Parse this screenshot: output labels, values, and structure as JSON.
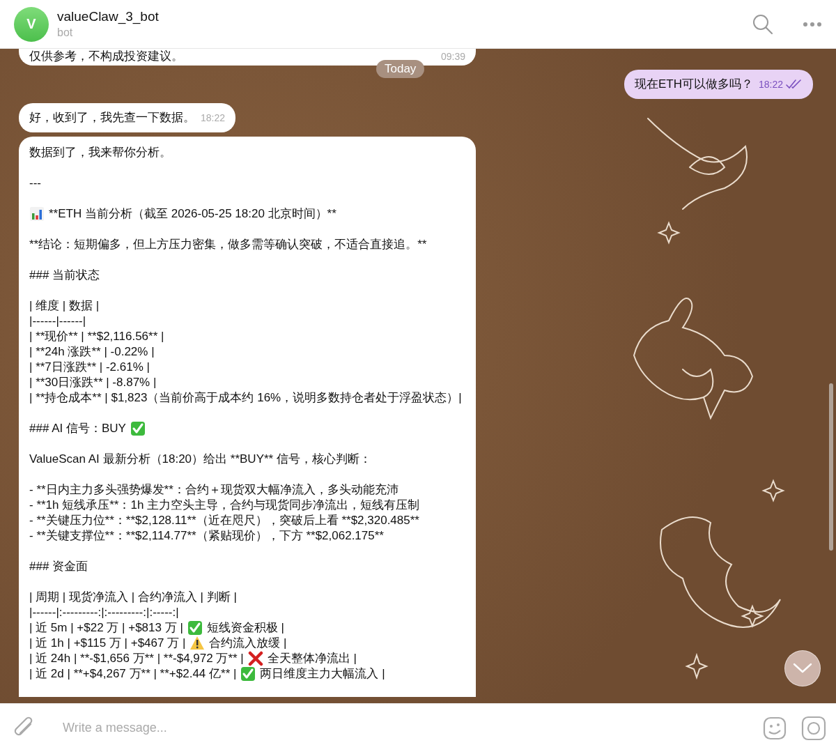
{
  "header": {
    "avatar_letter": "V",
    "title": "valueClaw_3_bot",
    "subtitle": "bot"
  },
  "date_chip": "Today",
  "messages": [
    {
      "kind": "incoming",
      "paragraphs": [
        [
          [
            {
              "kind": "text",
              "text": "仅供参考，不构成投资建议。"
            }
          ]
        ]
      ],
      "time": "09:39"
    },
    {
      "kind": "outgoing",
      "paragraphs": [
        [
          [
            {
              "kind": "text",
              "text": "现在ETH可以做多吗？"
            }
          ]
        ]
      ],
      "time": "18:22",
      "read": true
    },
    {
      "kind": "incoming",
      "paragraphs": [
        [
          [
            {
              "kind": "text",
              "text": "好，收到了，我先查一下数据。"
            }
          ]
        ]
      ],
      "time": "18:22"
    },
    {
      "kind": "incoming",
      "paragraphs": [
        [
          [
            {
              "kind": "text",
              "text": "数据到了，我来帮你分析。"
            }
          ]
        ],
        [
          [
            {
              "kind": "text",
              "text": "---"
            }
          ]
        ],
        [
          [
            {
              "kind": "chart"
            },
            {
              "kind": "text",
              "text": "**ETH 当前分析（截至 2026-05-25 18:20 北京时间）**"
            }
          ]
        ],
        [
          [
            {
              "kind": "text",
              "text": "**结论：短期偏多，但上方压力密集，做多需等确认突破，不适合直接追。**"
            }
          ]
        ],
        [
          [
            {
              "kind": "text",
              "text": "### 当前状态"
            }
          ]
        ],
        [
          [
            {
              "kind": "text",
              "text": "| 维度 | 数据 |"
            }
          ],
          [
            {
              "kind": "text",
              "text": "|------|------|"
            }
          ],
          [
            {
              "kind": "text",
              "text": "| **现价** | **$2,116.56** |"
            }
          ],
          [
            {
              "kind": "text",
              "text": "| **24h 涨跌** | -0.22% |"
            }
          ],
          [
            {
              "kind": "text",
              "text": "| **7日涨跌** | -2.61% |"
            }
          ],
          [
            {
              "kind": "text",
              "text": "| **30日涨跌** | -8.87% |"
            }
          ],
          [
            {
              "kind": "text",
              "text": "| **持仓成本** | $1,823（当前价高于成本约 16%，说明多数持仓者处于浮盈状态）|"
            }
          ]
        ],
        [
          [
            {
              "kind": "text",
              "text": "### AI 信号：BUY"
            },
            {
              "kind": "check"
            }
          ]
        ],
        [
          [
            {
              "kind": "text",
              "text": "ValueScan AI 最新分析（18:20）给出 **BUY** 信号，核心判断："
            }
          ]
        ],
        [
          [
            {
              "kind": "text",
              "text": "- **日内主力多头强势爆发**：合约＋现货双大幅净流入，多头动能充沛"
            }
          ],
          [
            {
              "kind": "text",
              "text": "- **1h 短线承压**：1h 主力空头主导，合约与现货同步净流出，短线有压制"
            }
          ],
          [
            {
              "kind": "text",
              "text": "- **关键压力位**：**$2,128.11**（近在咫尺），突破后上看 **$2,320.485**"
            }
          ],
          [
            {
              "kind": "text",
              "text": "- **关键支撑位**：**$2,114.77**（紧贴现价），下方 **$2,062.175**"
            }
          ]
        ],
        [
          [
            {
              "kind": "text",
              "text": "### 资金面"
            }
          ]
        ],
        [
          [
            {
              "kind": "text",
              "text": "| 周期 | 现货净流入 | 合约净流入 | 判断 |"
            }
          ],
          [
            {
              "kind": "text",
              "text": "|------|:---------:|:---------:|:-----:|"
            }
          ],
          [
            {
              "kind": "text",
              "text": "| 近 5m | +$22 万 | +$813 万 |"
            },
            {
              "kind": "check"
            },
            {
              "kind": "text",
              "text": "短线资金积极 |"
            }
          ],
          [
            {
              "kind": "text",
              "text": "| 近 1h | +$115 万 | +$467 万 |"
            },
            {
              "kind": "warning"
            },
            {
              "kind": "text",
              "text": "合约流入放缓 |"
            }
          ],
          [
            {
              "kind": "text",
              "text": "| 近 24h | **-$1,656 万** | **-$4,972 万** |"
            },
            {
              "kind": "cross"
            },
            {
              "kind": "text",
              "text": "全天整体净流出 |"
            }
          ],
          [
            {
              "kind": "text",
              "text": "| 近 2d | **+$4,267 万** | **+$2.44 亿** |"
            },
            {
              "kind": "check"
            },
            {
              "kind": "text",
              "text": "两日维度主力大幅流入 |"
            }
          ]
        ]
      ]
    }
  ],
  "composer": {
    "placeholder": "Write a message..."
  }
}
